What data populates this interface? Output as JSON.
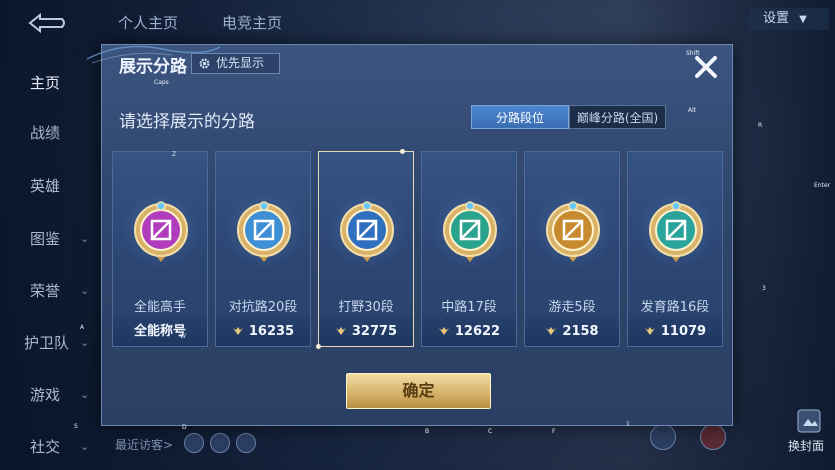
{
  "top_tabs": [
    "个人主页",
    "电竞主页"
  ],
  "settings_label": "设置",
  "sidebar": [
    {
      "label": "主页",
      "has_chevron": false,
      "active": true
    },
    {
      "label": "战绩",
      "has_chevron": false
    },
    {
      "label": "英雄",
      "has_chevron": false
    },
    {
      "label": "图鉴",
      "has_chevron": true
    },
    {
      "label": "荣誉",
      "has_chevron": true
    },
    {
      "label": "护卫队",
      "has_chevron": true
    },
    {
      "label": "游戏",
      "has_chevron": true
    },
    {
      "label": "社交",
      "has_chevron": true
    }
  ],
  "recent_visitors": "最近访客>",
  "change_cover": "换封面",
  "modal": {
    "title": "展示分路",
    "priority_label": "优先显示",
    "subtitle": "请选择展示的分路",
    "seg_tabs": [
      "分路段位",
      "巅峰分路(全国)"
    ],
    "active_seg": 0,
    "confirm_label": "确定",
    "cards": [
      {
        "name": "全能高手",
        "stat": "全能称号",
        "has_coin": false,
        "color": "#b13dbd",
        "icon": "omni-emblem-icon"
      },
      {
        "name": "对抗路20段",
        "stat": "16235",
        "has_coin": true,
        "color": "#3f8fd6",
        "icon": "clash-lane-emblem-icon"
      },
      {
        "name": "打野30段",
        "stat": "32775",
        "has_coin": true,
        "color": "#2f6fc0",
        "icon": "jungle-emblem-icon",
        "selected": true
      },
      {
        "name": "中路17段",
        "stat": "12622",
        "has_coin": true,
        "color": "#2aa38c",
        "icon": "mid-lane-emblem-icon"
      },
      {
        "name": "游走5段",
        "stat": "2158",
        "has_coin": true,
        "color": "#c78a2f",
        "icon": "roam-emblem-icon"
      },
      {
        "name": "发育路16段",
        "stat": "11079",
        "has_coin": true,
        "color": "#2aa39a",
        "icon": "farm-lane-emblem-icon"
      }
    ]
  },
  "overlay_letters": [
    "Caps",
    "Z",
    "Alt",
    "R",
    "Shift",
    "Enter",
    "A",
    "W",
    "S",
    "D",
    "B",
    "C",
    "F",
    "1",
    "3"
  ]
}
